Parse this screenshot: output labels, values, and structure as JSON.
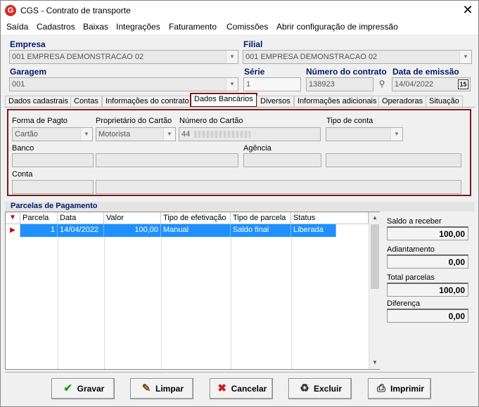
{
  "window": {
    "app_letter": "G",
    "title": "CGS - Contrato de transporte",
    "close": "✕"
  },
  "menu": [
    "Saída",
    "Cadastros",
    "Baixas",
    "Integrações",
    "Faturamento",
    "Comissões",
    "Abrir configuração de impressão"
  ],
  "header": {
    "empresa_label": "Empresa",
    "empresa_value": "001 EMPRESA DEMONSTRACAO 02",
    "filial_label": "Filial",
    "filial_value": "001 EMPRESA DEMONSTRACAO 02",
    "garagem_label": "Garagem",
    "garagem_value": "001",
    "serie_label": "Série",
    "serie_value": "1",
    "numero_label": "Número do contrato",
    "numero_value": "138923",
    "data_label": "Data de emissão",
    "data_value": "14/04/2022",
    "calendar_glyph": "15"
  },
  "tabs": [
    "Dados cadastrais",
    "Contas",
    "Informações do contrato",
    "Dados Bancários",
    "Diversos",
    "Informações adicionais",
    "Operadoras",
    "Situação"
  ],
  "bank": {
    "forma_label": "Forma de Pagto",
    "forma_value": "Cartão",
    "proprietario_label": "Proprietário do Cartão",
    "proprietario_value": "Motorista",
    "numero_cartao_label": "Número do Cartão",
    "numero_cartao_value": "44",
    "tipo_conta_label": "Tipo de conta",
    "banco_label": "Banco",
    "agencia_label": "Agência",
    "conta_label": "Conta"
  },
  "parcelas": {
    "title": "Parcelas de Pagamento",
    "columns": [
      "Parcela",
      "Data",
      "Valor",
      "Tipo de efetivação",
      "Tipo de parcela",
      "Status"
    ],
    "rows": [
      {
        "parcela": "1",
        "data": "14/04/2022",
        "valor": "100,00",
        "tipo_efetivacao": "Manual",
        "tipo_parcela": "Saldo final",
        "status": "Liberada"
      }
    ]
  },
  "summary": {
    "saldo_label": "Saldo a receber",
    "saldo_value": "100,00",
    "adiantamento_label": "Adiantamento",
    "adiantamento_value": "0,00",
    "total_label": "Total parcelas",
    "total_value": "100,00",
    "diferenca_label": "Diferença",
    "diferenca_value": "0,00"
  },
  "buttons": {
    "gravar": "Gravar",
    "limpar": "Limpar",
    "cancelar": "Cancelar",
    "excluir": "Excluir",
    "imprimir": "Imprimir"
  },
  "colors": {
    "accent_red": "#7a1a1a",
    "selection_blue": "#1e90ff",
    "label_blue": "#001b6a",
    "check_green": "#1a9a1a",
    "cancel_red": "#c81e1e"
  }
}
